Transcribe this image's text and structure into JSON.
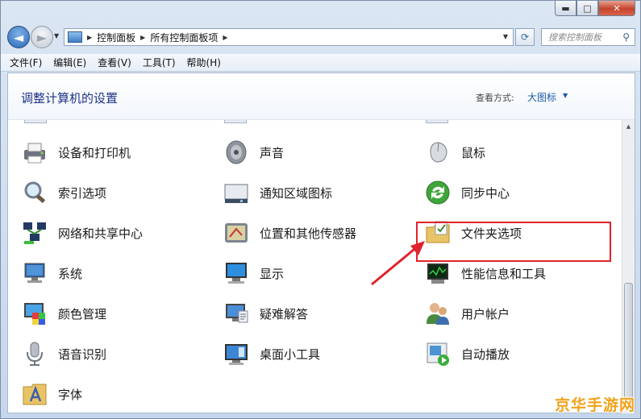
{
  "window": {
    "title": "",
    "controls": {
      "minimize": "▬",
      "maximize": "□",
      "close": "✕"
    }
  },
  "nav": {
    "back": "◄",
    "forward": "►",
    "breadcrumb": [
      "控制面板",
      "所有控制面板项"
    ],
    "search_placeholder": "搜索控制面板"
  },
  "menu": [
    "文件(F)",
    "编辑(E)",
    "查看(V)",
    "工具(T)",
    "帮助(H)"
  ],
  "header": {
    "title": "调整计算机的设置",
    "view_label": "查看方式:",
    "view_value": "大图标"
  },
  "items": [
    {
      "label": "设备和打印机",
      "icon": "printer-icon"
    },
    {
      "label": "声音",
      "icon": "speaker-icon"
    },
    {
      "label": "鼠标",
      "icon": "mouse-icon"
    },
    {
      "label": "索引选项",
      "icon": "magnifier-icon"
    },
    {
      "label": "通知区域图标",
      "icon": "taskbar-icon"
    },
    {
      "label": "同步中心",
      "icon": "sync-icon"
    },
    {
      "label": "网络和共享中心",
      "icon": "network-icon"
    },
    {
      "label": "位置和其他传感器",
      "icon": "sensor-icon"
    },
    {
      "label": "文件夹选项",
      "icon": "folder-options-icon"
    },
    {
      "label": "系统",
      "icon": "computer-icon"
    },
    {
      "label": "显示",
      "icon": "display-icon"
    },
    {
      "label": "性能信息和工具",
      "icon": "performance-icon"
    },
    {
      "label": "颜色管理",
      "icon": "color-icon"
    },
    {
      "label": "疑难解答",
      "icon": "troubleshoot-icon"
    },
    {
      "label": "用户帐户",
      "icon": "users-icon"
    },
    {
      "label": "语音识别",
      "icon": "microphone-icon"
    },
    {
      "label": "桌面小工具",
      "icon": "gadgets-icon"
    },
    {
      "label": "自动播放",
      "icon": "autoplay-icon"
    },
    {
      "label": "字体",
      "icon": "fonts-icon"
    }
  ],
  "colors": {
    "highlight": "#e0232d",
    "title": "#1e3287",
    "link": "#1e5aa8"
  },
  "watermark": "京华手游网"
}
